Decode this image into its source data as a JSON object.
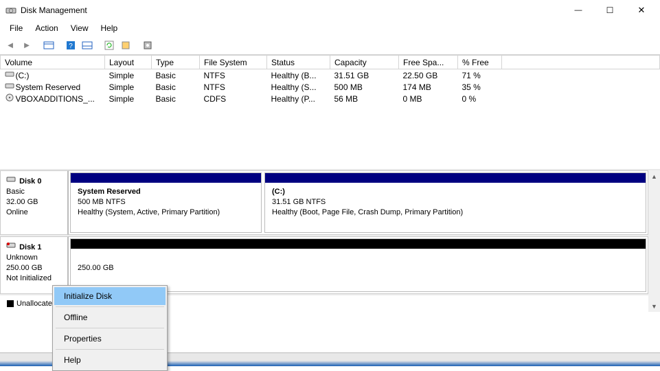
{
  "window": {
    "title": "Disk Management"
  },
  "menu": {
    "file": "File",
    "action": "Action",
    "view": "View",
    "help": "Help"
  },
  "columns": {
    "volume": "Volume",
    "layout": "Layout",
    "type": "Type",
    "fs": "File System",
    "status": "Status",
    "capacity": "Capacity",
    "free": "Free Spa...",
    "pct": "% Free"
  },
  "volumes": [
    {
      "name": "(C:)",
      "layout": "Simple",
      "type": "Basic",
      "fs": "NTFS",
      "status": "Healthy (B...",
      "capacity": "31.51 GB",
      "free": "22.50 GB",
      "pct": "71 %"
    },
    {
      "name": "System Reserved",
      "layout": "Simple",
      "type": "Basic",
      "fs": "NTFS",
      "status": "Healthy (S...",
      "capacity": "500 MB",
      "free": "174 MB",
      "pct": "35 %"
    },
    {
      "name": "VBOXADDITIONS_...",
      "layout": "Simple",
      "type": "Basic",
      "fs": "CDFS",
      "status": "Healthy (P...",
      "capacity": "56 MB",
      "free": "0 MB",
      "pct": "0 %"
    }
  ],
  "disks": [
    {
      "name": "Disk 0",
      "kind": "Basic",
      "size": "32.00 GB",
      "state": "Online",
      "partitions": [
        {
          "title": "System Reserved",
          "size": "500 MB NTFS",
          "status": "Healthy (System, Active, Primary Partition)",
          "flex": "1"
        },
        {
          "title": "(C:)",
          "size": "31.51 GB NTFS",
          "status": "Healthy (Boot, Page File, Crash Dump, Primary Partition)",
          "flex": "2"
        }
      ]
    },
    {
      "name": "Disk 1",
      "kind": "Unknown",
      "size": "250.00 GB",
      "state": "Not Initialized",
      "unallocated_size": "250.00 GB"
    }
  ],
  "legend": {
    "unallocated": "Unallocated"
  },
  "context_menu": {
    "init": "Initialize Disk",
    "offline": "Offline",
    "properties": "Properties",
    "help": "Help"
  }
}
